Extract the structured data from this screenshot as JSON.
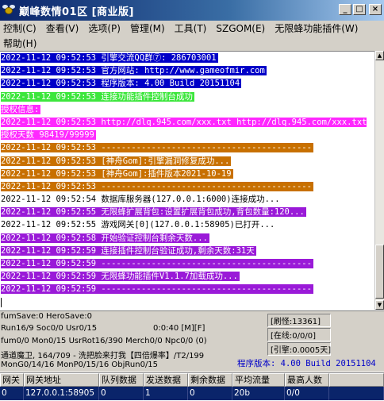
{
  "window": {
    "title": "巅峰数情01区 [商业版]",
    "min_label": "_",
    "max_label": "□",
    "close_label": "×"
  },
  "menu": {
    "row1": [
      "控制(C)",
      "查看(V)",
      "选项(P)",
      "管理(M)",
      "工具(T)",
      "SZGOM(E)",
      "无限蜂功能插件(W)"
    ],
    "row2": [
      "帮助(H)"
    ]
  },
  "log": [
    {
      "color": "blue",
      "text": "2022-11-12 09:52:53 引擎交流QQ群⑦: 286703001"
    },
    {
      "color": "blue",
      "text": "2022-11-12 09:52:53 官方网站: http://www.gameofmir.com"
    },
    {
      "color": "blue",
      "text": "2022-11-12 09:52:53 程序版本: 4.00 Build 20151104"
    },
    {
      "color": "green",
      "text": "2022-11-12 09:52:53 连接功能插件控制台成功"
    },
    {
      "color": "pink",
      "text": "授权信息:"
    },
    {
      "color": "pink",
      "text": "2022-11-12 09:52:53 http://dlq.945.com/xxx.txt http://dlq.945.com/xxx.txt 授权天数 98419/99999"
    },
    {
      "color": "orange",
      "text": "2022-11-12 09:52:53 ------------------------------------------"
    },
    {
      "color": "orange",
      "text": "2022-11-12 09:52:53 [神舟Gom]:引擎漏洞修复成功..."
    },
    {
      "color": "orange",
      "text": "2022-11-12 09:52:53 [神舟Gom]:插件版本2021-10-19"
    },
    {
      "color": "orange",
      "text": "2022-11-12 09:52:53 ------------------------------------------"
    },
    {
      "color": "plain",
      "text": "2022-11-12 09:52:54 数据库服务器(127.0.0.1:6000)连接成功..."
    },
    {
      "color": "purple",
      "text": "2022-11-12 09:52:55 无限蜂扩展背包:设置扩展背包成功,背包数量:120..."
    },
    {
      "color": "plain",
      "text": "2022-11-12 09:52:55 游戏网关[0](127.0.0.1:58905)已打开..."
    },
    {
      "color": "purple",
      "text": "2022-11-12 09:52:58 开始验证控制台剩余天数..."
    },
    {
      "color": "purple",
      "text": "2022-11-12 09:52:59 连接插件控制台验证成功,剩余天数:31天"
    },
    {
      "color": "purple",
      "text": "2022-11-12 09:52:59 ------------------------------------------"
    },
    {
      "color": "purple",
      "text": "2022-11-12 09:52:59 无限蜂功能插件V1.1.7加载成功..."
    },
    {
      "color": "purple",
      "text": "2022-11-12 09:52:59 ------------------------------------------"
    }
  ],
  "status": {
    "line1": "fumSave:0 HeroSave:0",
    "line2_left": "Run16/9 Soc0/0 Usr0/15",
    "line2_mid": "0:0:40 [M][F]",
    "line3": "fum0/0 Mon0/15 UsrRot16/390 Merch0/0 Npc0/0 (0)",
    "line4": "通道魔卫, 164/709 - 洗把脸来打我【四倍爆率】/T2/199",
    "line5": "MonG0/14/16 MonP0/15/16 ObjRun0/15",
    "refresh": "[刷怪:13361]",
    "online": "[在线:0/0/0]",
    "engine": "[引擎:0.0005天]",
    "version": "程序版本: 4.00 Build 20151104"
  },
  "table": {
    "headers": [
      "网关",
      "网关地址",
      "队列数据",
      "发送数据",
      "剩余数据",
      "平均流量",
      "最高人数"
    ],
    "rows": [
      [
        "0",
        "127.0.0.1:58905",
        "0",
        "1",
        "0",
        "20b",
        "0/0"
      ]
    ]
  },
  "colors": {
    "blue": "#0000c8",
    "green": "#3ce63c",
    "pink": "#ff28ff",
    "orange": "#c87000",
    "purple": "#9a1ad8",
    "selection": "#0a246a"
  }
}
